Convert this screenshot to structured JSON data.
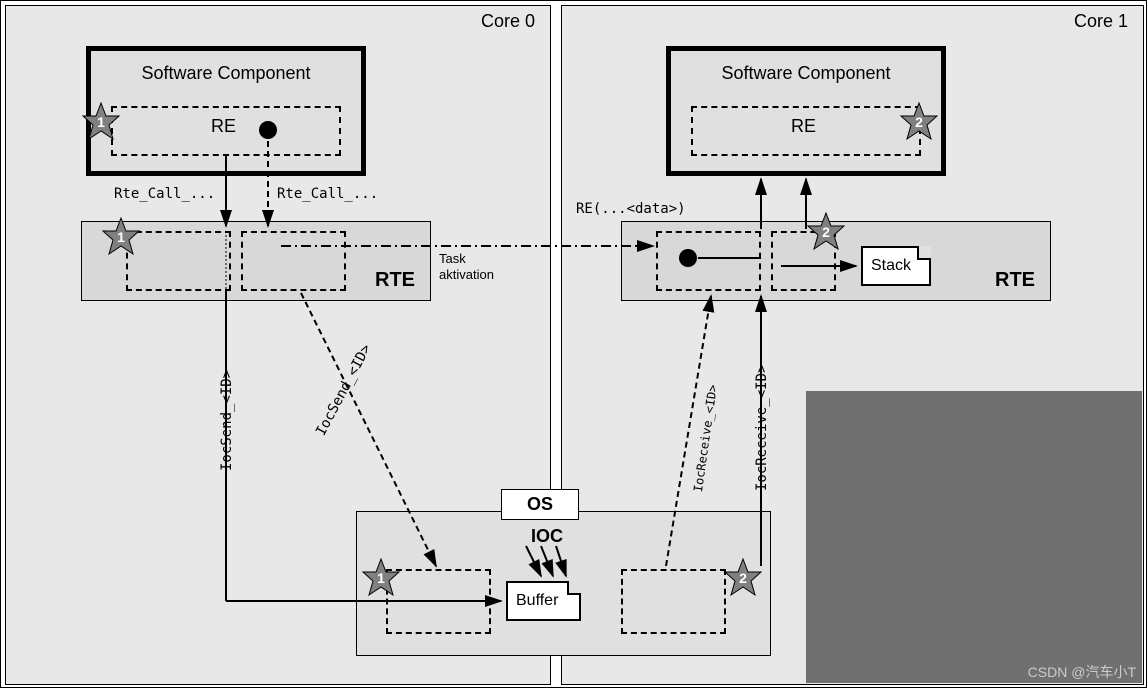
{
  "cores": {
    "core0": {
      "label": "Core 0"
    },
    "core1": {
      "label": "Core 1"
    }
  },
  "swc": {
    "title": "Software Component",
    "re_label": "RE"
  },
  "rte": {
    "label": "RTE"
  },
  "os": {
    "label": "OS",
    "ioc_label": "IOC",
    "buffer_label": "Buffer",
    "stack_label": "Stack"
  },
  "calls": {
    "rte_call1": "Rte_Call_...",
    "rte_call2": "Rte_Call_...",
    "re_data": "RE(...<data>)",
    "ioc_send1": "IocSend_<ID>",
    "ioc_send2": "IocSend_<ID>",
    "ioc_recv1": "IocReceive_<ID>",
    "ioc_recv2": "IocReceive_<ID>",
    "task_act": "Task\naktivation"
  },
  "stars": {
    "one": "1",
    "two": "2"
  },
  "watermark": "CSDN @汽车小T"
}
